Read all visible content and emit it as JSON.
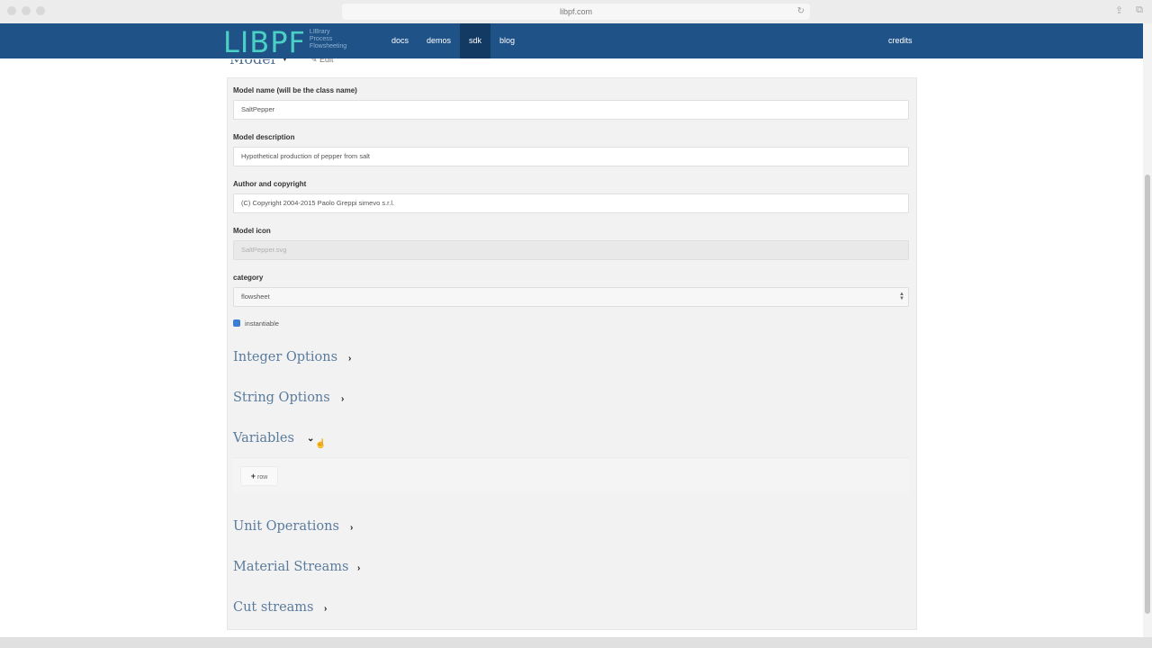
{
  "browser": {
    "url": "libpf.com"
  },
  "navbar": {
    "logo_text": "LIBPF",
    "logo_sub": [
      "LIBrary",
      "Process",
      "Flowsheeting"
    ],
    "links": [
      {
        "label": "docs",
        "active": false
      },
      {
        "label": "demos",
        "active": false
      },
      {
        "label": "sdk",
        "active": true
      },
      {
        "label": "blog",
        "active": false
      }
    ],
    "credits": "credits"
  },
  "header": {
    "title": "Model",
    "edit_label": "Edit"
  },
  "form": {
    "model_name_label": "Model name (will be the class name)",
    "model_name_value": "SaltPepper",
    "model_description_label": "Model description",
    "model_description_value": "Hypothetical production of pepper from salt",
    "author_label": "Author and copyright",
    "author_value": "(C) Copyright 2004-2015 Paolo Greppi simevo s.r.l.",
    "icon_label": "Model icon",
    "icon_value": "SaltPepper.svg",
    "category_label": "category",
    "category_value": "flowsheet",
    "instantiable_label": "instantiable",
    "instantiable_checked": true
  },
  "sections": {
    "integer_options": "Integer Options",
    "string_options": "String Options",
    "variables": "Variables",
    "unit_operations": "Unit Operations",
    "material_streams": "Material Streams",
    "cut_streams": "Cut streams"
  },
  "variables": {
    "new_row_label": "row"
  },
  "colors": {
    "navbar": "#1f5287",
    "logo": "#4ad0c5",
    "section_title": "#5a7b9c",
    "checkbox": "#3b7ed6"
  }
}
